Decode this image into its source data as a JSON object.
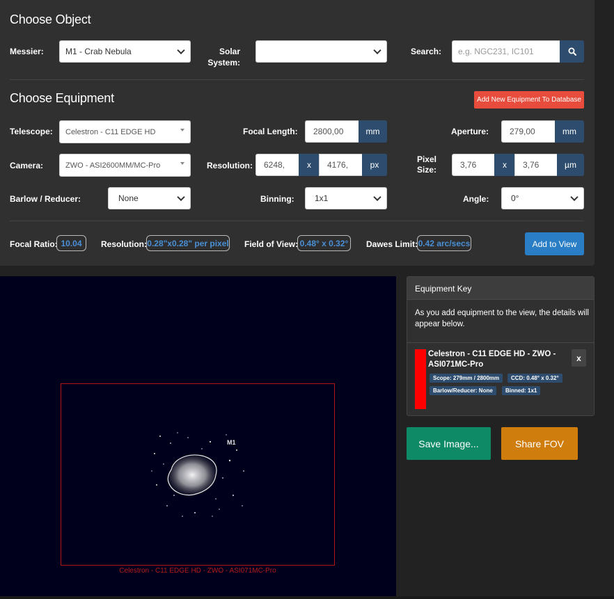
{
  "object_section": {
    "title": "Choose Object",
    "messier_label": "Messier:",
    "messier_value": "M1 - Crab Nebula",
    "solar_label_line1": "Solar",
    "solar_label_line2": "System:",
    "solar_value": "",
    "search_label": "Search:",
    "search_placeholder": "e.g. NGC231, IC101",
    "search_icon": "search-icon"
  },
  "equipment_section": {
    "title": "Choose Equipment",
    "add_new_button": "Add New Equipment To Database",
    "telescope_label": "Telescope:",
    "telescope_value": "Celestron - C11 EDGE HD",
    "focal_length_label": "Focal Length:",
    "focal_length_value": "2800,00",
    "focal_length_unit": "mm",
    "aperture_label": "Aperture:",
    "aperture_value": "279,00",
    "aperture_unit": "mm",
    "camera_label": "Camera:",
    "camera_value": "ZWO - ASI2600MM/MC-Pro",
    "resolution_label": "Resolution:",
    "resolution_x": "6248,",
    "resolution_sep": "x",
    "resolution_y": "4176,",
    "resolution_unit": "px",
    "pixel_size_label_line1": "Pixel",
    "pixel_size_label_line2": "Size:",
    "pixel_size_x": "3,76",
    "pixel_size_sep": "x",
    "pixel_size_y": "3,76",
    "pixel_size_unit": "µm",
    "barlow_label": "Barlow / Reducer:",
    "barlow_value": "None",
    "binning_label": "Binning:",
    "binning_value": "1x1",
    "angle_label": "Angle:",
    "angle_value": "0°"
  },
  "results": {
    "focal_ratio_label": "Focal Ratio:",
    "focal_ratio_value": "10.04",
    "resolution_label": "Resolution:",
    "resolution_value": "0.28\"x0.28\" per pixel",
    "fov_label": "Field of View:",
    "fov_value": "0.48° x 0.32°",
    "dawes_label": "Dawes Limit:",
    "dawes_value": "0.42 arc/secs",
    "add_to_view_button": "Add to View"
  },
  "viewer": {
    "object_label": "M1",
    "fov_caption": "Celestron - C11 EDGE HD - ZWO - ASI071MC-Pro",
    "fov_color": "#b01818"
  },
  "equipment_key": {
    "header": "Equipment Key",
    "description": "As you add equipment to the view, the details will appear below.",
    "item": {
      "color": "#ff0000",
      "name": "Celestron - C11 EDGE HD - ZWO - ASI071MC-Pro",
      "badge_scope": "Scope: 279mm / 2800mm",
      "badge_ccd": "CCD: 0.48° x 0.32°",
      "badge_barlow": "Barlow/Reducer: None",
      "badge_binned": "Binned: 1x1",
      "remove_label": "x"
    }
  },
  "actions": {
    "save_image": "Save Image...",
    "share_fov": "Share FOV"
  },
  "colors": {
    "accent_blue": "#2a7ec6",
    "addon_navy": "#2e4d6e",
    "danger_red": "#e74c3c",
    "save_green": "#0e8a66",
    "share_orange": "#cf7d0d"
  }
}
